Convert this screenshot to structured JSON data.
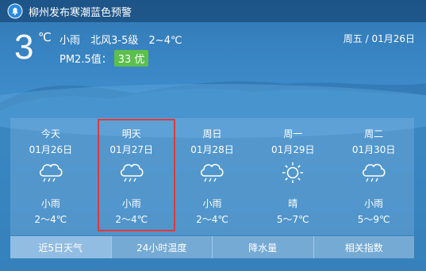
{
  "alert": {
    "text": "柳州发布寒潮蓝色预警",
    "icon": "bell-icon"
  },
  "current": {
    "temp": "3",
    "unit": "℃",
    "condition": "小雨",
    "wind": "北风3-5级",
    "range": "2~4℃",
    "pm_label": "PM2.5值：",
    "aqi": "33 优",
    "aqi_color": "#5cbf4e",
    "date": "周五 / 01月26日"
  },
  "forecast": [
    {
      "name": "今天",
      "date": "01月26日",
      "icon": "rain-cloud-icon",
      "cond": "小雨",
      "range": "2～4℃"
    },
    {
      "name": "明天",
      "date": "01月27日",
      "icon": "rain-cloud-icon",
      "cond": "小雨",
      "range": "2～4℃"
    },
    {
      "name": "周日",
      "date": "01月28日",
      "icon": "rain-cloud-icon",
      "cond": "小雨",
      "range": "2～4℃"
    },
    {
      "name": "周一",
      "date": "01月29日",
      "icon": "sun-icon",
      "cond": "晴",
      "range": "5～7℃"
    },
    {
      "name": "周二",
      "date": "01月30日",
      "icon": "rain-cloud-icon",
      "cond": "小雨",
      "range": "5～9℃"
    }
  ],
  "tabs": [
    "近5日天气",
    "24小时温度",
    "降水量",
    "相关指数"
  ],
  "colors": {
    "highlight_border": "#e0393a"
  }
}
